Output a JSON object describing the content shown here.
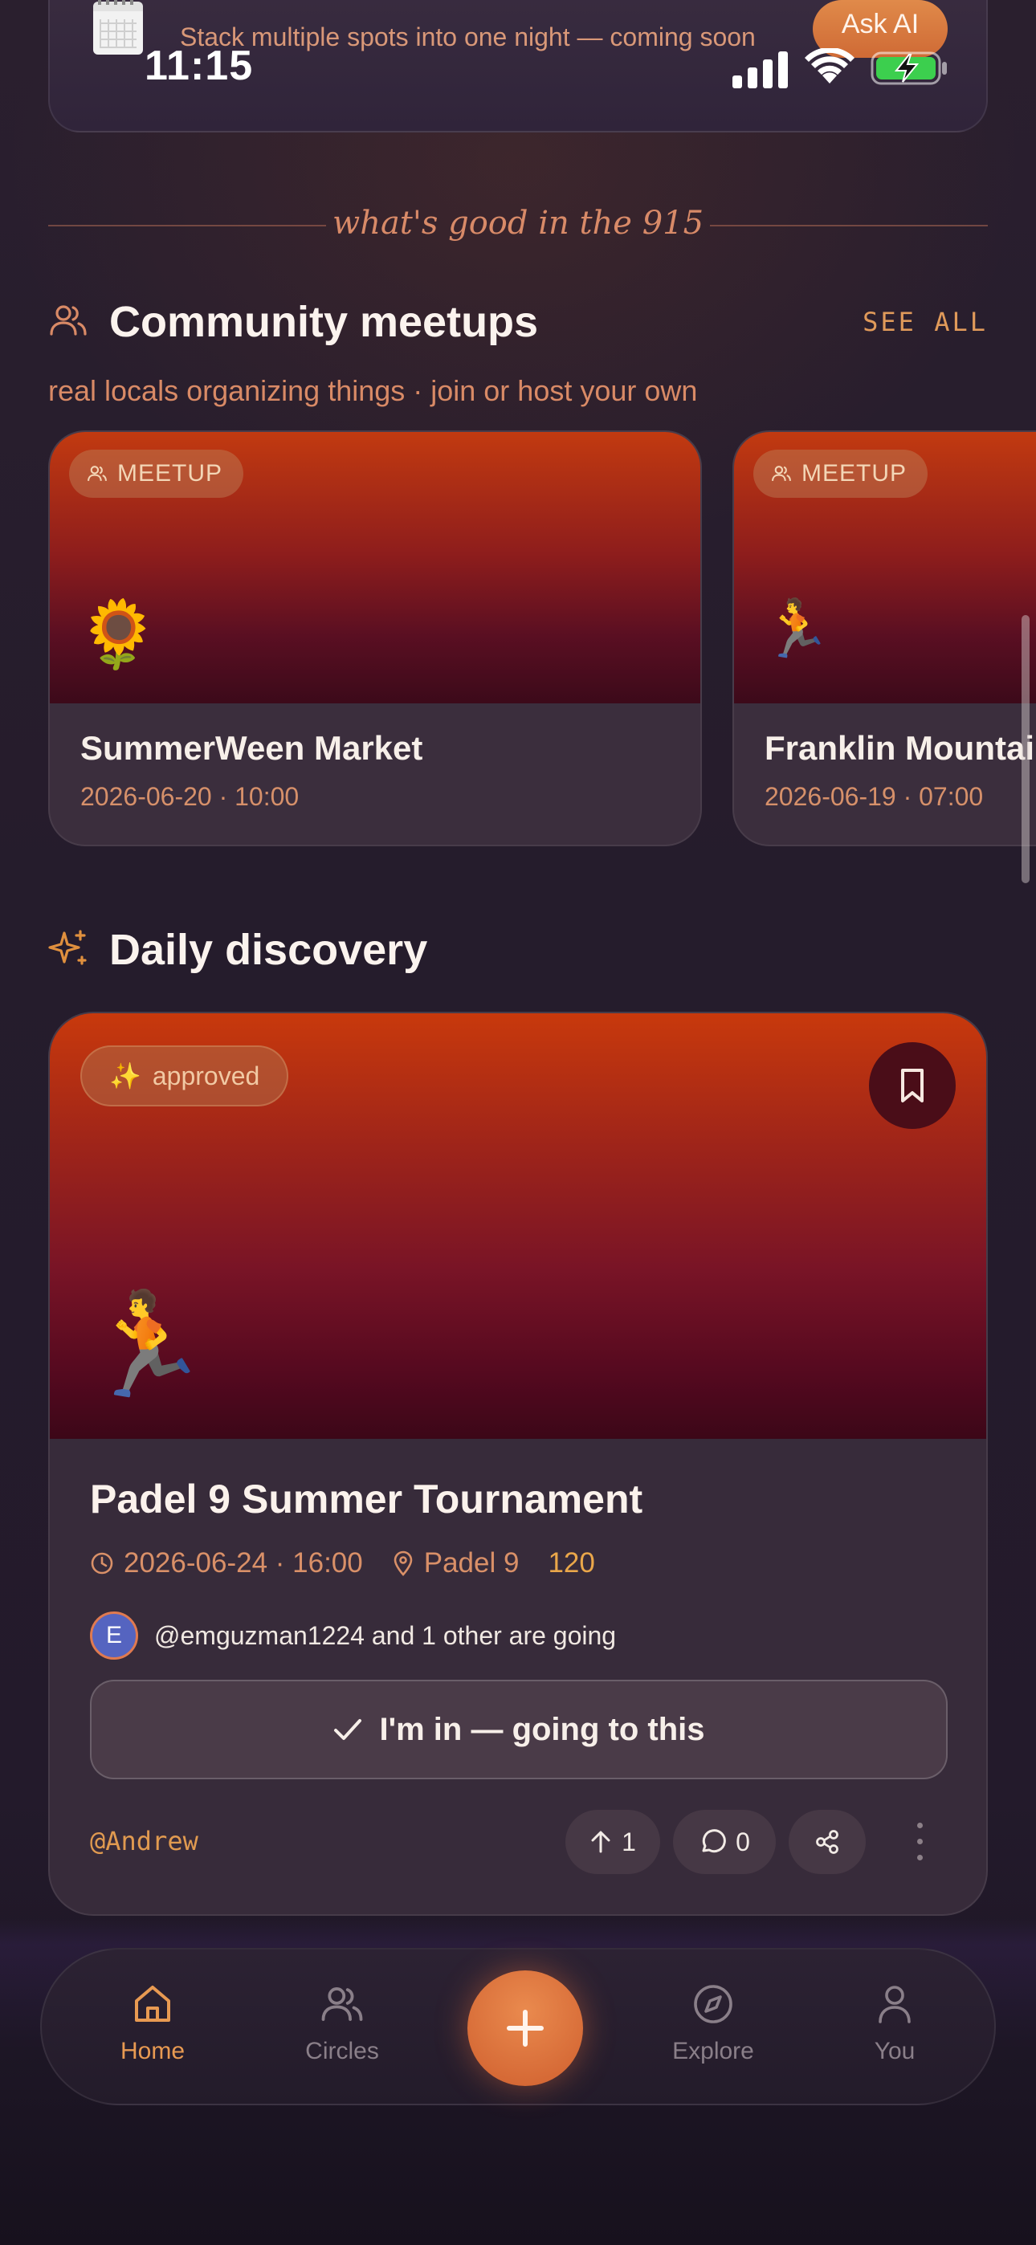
{
  "status_bar": {
    "time": "11:15"
  },
  "top_banner": {
    "text": "Stack multiple spots into one night — coming soon",
    "ask_ai_label": "Ask AI"
  },
  "divider": {
    "text": "what's good in the 915"
  },
  "meetups": {
    "title": "Community meetups",
    "see_all": "SEE ALL",
    "subtitle": "real locals organizing things · join or host your own",
    "cards": [
      {
        "tag": "MEETUP",
        "emoji": "🌻",
        "name": "SummerWeen Market",
        "when": "2026-06-20 · 10:00"
      },
      {
        "tag": "MEETUP",
        "emoji": "🏃",
        "name": "Franklin Mountains",
        "when": "2026-06-19 · 07:00"
      }
    ]
  },
  "discovery": {
    "title": "Daily discovery",
    "card": {
      "badge": "approved",
      "badge_emoji": "✨",
      "emoji": "🏃",
      "title": "Padel 9 Summer Tournament",
      "datetime": "2026-06-24 · 16:00",
      "venue": "Padel 9",
      "count": "120",
      "avatar_initial": "E",
      "going_text": "@emguzman1224 and 1 other are going",
      "rsvp_label": "I'm in — going to this",
      "author": "@Andrew",
      "upvotes": "1",
      "comments": "0"
    }
  },
  "nav": {
    "home": "Home",
    "circles": "Circles",
    "explore": "Explore",
    "you": "You"
  },
  "colors": {
    "accent": "#e89a52",
    "hero_top": "#c8390c",
    "hero_bottom": "#3c0718",
    "background": "#241b2c"
  }
}
